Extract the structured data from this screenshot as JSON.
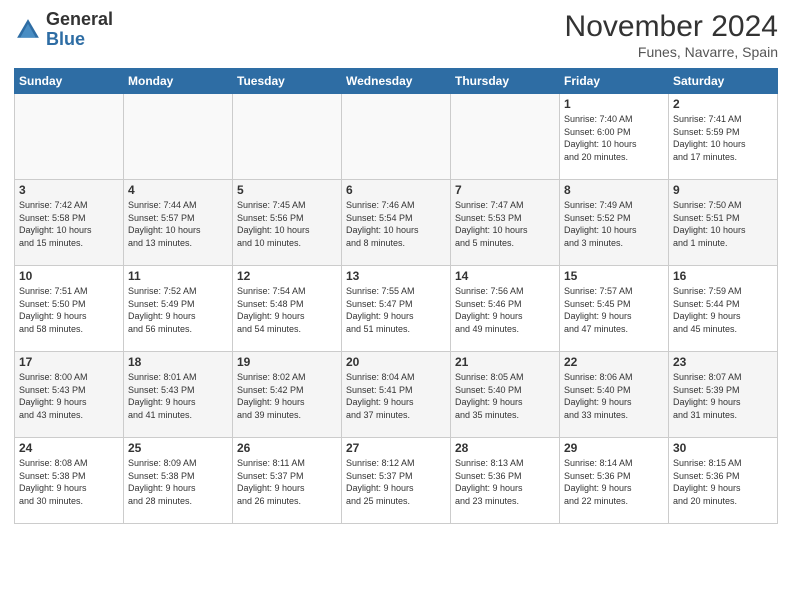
{
  "header": {
    "logo_general": "General",
    "logo_blue": "Blue",
    "month_title": "November 2024",
    "subtitle": "Funes, Navarre, Spain"
  },
  "weekdays": [
    "Sunday",
    "Monday",
    "Tuesday",
    "Wednesday",
    "Thursday",
    "Friday",
    "Saturday"
  ],
  "weeks": [
    [
      {
        "day": "",
        "info": ""
      },
      {
        "day": "",
        "info": ""
      },
      {
        "day": "",
        "info": ""
      },
      {
        "day": "",
        "info": ""
      },
      {
        "day": "",
        "info": ""
      },
      {
        "day": "1",
        "info": "Sunrise: 7:40 AM\nSunset: 6:00 PM\nDaylight: 10 hours\nand 20 minutes."
      },
      {
        "day": "2",
        "info": "Sunrise: 7:41 AM\nSunset: 5:59 PM\nDaylight: 10 hours\nand 17 minutes."
      }
    ],
    [
      {
        "day": "3",
        "info": "Sunrise: 7:42 AM\nSunset: 5:58 PM\nDaylight: 10 hours\nand 15 minutes."
      },
      {
        "day": "4",
        "info": "Sunrise: 7:44 AM\nSunset: 5:57 PM\nDaylight: 10 hours\nand 13 minutes."
      },
      {
        "day": "5",
        "info": "Sunrise: 7:45 AM\nSunset: 5:56 PM\nDaylight: 10 hours\nand 10 minutes."
      },
      {
        "day": "6",
        "info": "Sunrise: 7:46 AM\nSunset: 5:54 PM\nDaylight: 10 hours\nand 8 minutes."
      },
      {
        "day": "7",
        "info": "Sunrise: 7:47 AM\nSunset: 5:53 PM\nDaylight: 10 hours\nand 5 minutes."
      },
      {
        "day": "8",
        "info": "Sunrise: 7:49 AM\nSunset: 5:52 PM\nDaylight: 10 hours\nand 3 minutes."
      },
      {
        "day": "9",
        "info": "Sunrise: 7:50 AM\nSunset: 5:51 PM\nDaylight: 10 hours\nand 1 minute."
      }
    ],
    [
      {
        "day": "10",
        "info": "Sunrise: 7:51 AM\nSunset: 5:50 PM\nDaylight: 9 hours\nand 58 minutes."
      },
      {
        "day": "11",
        "info": "Sunrise: 7:52 AM\nSunset: 5:49 PM\nDaylight: 9 hours\nand 56 minutes."
      },
      {
        "day": "12",
        "info": "Sunrise: 7:54 AM\nSunset: 5:48 PM\nDaylight: 9 hours\nand 54 minutes."
      },
      {
        "day": "13",
        "info": "Sunrise: 7:55 AM\nSunset: 5:47 PM\nDaylight: 9 hours\nand 51 minutes."
      },
      {
        "day": "14",
        "info": "Sunrise: 7:56 AM\nSunset: 5:46 PM\nDaylight: 9 hours\nand 49 minutes."
      },
      {
        "day": "15",
        "info": "Sunrise: 7:57 AM\nSunset: 5:45 PM\nDaylight: 9 hours\nand 47 minutes."
      },
      {
        "day": "16",
        "info": "Sunrise: 7:59 AM\nSunset: 5:44 PM\nDaylight: 9 hours\nand 45 minutes."
      }
    ],
    [
      {
        "day": "17",
        "info": "Sunrise: 8:00 AM\nSunset: 5:43 PM\nDaylight: 9 hours\nand 43 minutes."
      },
      {
        "day": "18",
        "info": "Sunrise: 8:01 AM\nSunset: 5:43 PM\nDaylight: 9 hours\nand 41 minutes."
      },
      {
        "day": "19",
        "info": "Sunrise: 8:02 AM\nSunset: 5:42 PM\nDaylight: 9 hours\nand 39 minutes."
      },
      {
        "day": "20",
        "info": "Sunrise: 8:04 AM\nSunset: 5:41 PM\nDaylight: 9 hours\nand 37 minutes."
      },
      {
        "day": "21",
        "info": "Sunrise: 8:05 AM\nSunset: 5:40 PM\nDaylight: 9 hours\nand 35 minutes."
      },
      {
        "day": "22",
        "info": "Sunrise: 8:06 AM\nSunset: 5:40 PM\nDaylight: 9 hours\nand 33 minutes."
      },
      {
        "day": "23",
        "info": "Sunrise: 8:07 AM\nSunset: 5:39 PM\nDaylight: 9 hours\nand 31 minutes."
      }
    ],
    [
      {
        "day": "24",
        "info": "Sunrise: 8:08 AM\nSunset: 5:38 PM\nDaylight: 9 hours\nand 30 minutes."
      },
      {
        "day": "25",
        "info": "Sunrise: 8:09 AM\nSunset: 5:38 PM\nDaylight: 9 hours\nand 28 minutes."
      },
      {
        "day": "26",
        "info": "Sunrise: 8:11 AM\nSunset: 5:37 PM\nDaylight: 9 hours\nand 26 minutes."
      },
      {
        "day": "27",
        "info": "Sunrise: 8:12 AM\nSunset: 5:37 PM\nDaylight: 9 hours\nand 25 minutes."
      },
      {
        "day": "28",
        "info": "Sunrise: 8:13 AM\nSunset: 5:36 PM\nDaylight: 9 hours\nand 23 minutes."
      },
      {
        "day": "29",
        "info": "Sunrise: 8:14 AM\nSunset: 5:36 PM\nDaylight: 9 hours\nand 22 minutes."
      },
      {
        "day": "30",
        "info": "Sunrise: 8:15 AM\nSunset: 5:36 PM\nDaylight: 9 hours\nand 20 minutes."
      }
    ]
  ]
}
